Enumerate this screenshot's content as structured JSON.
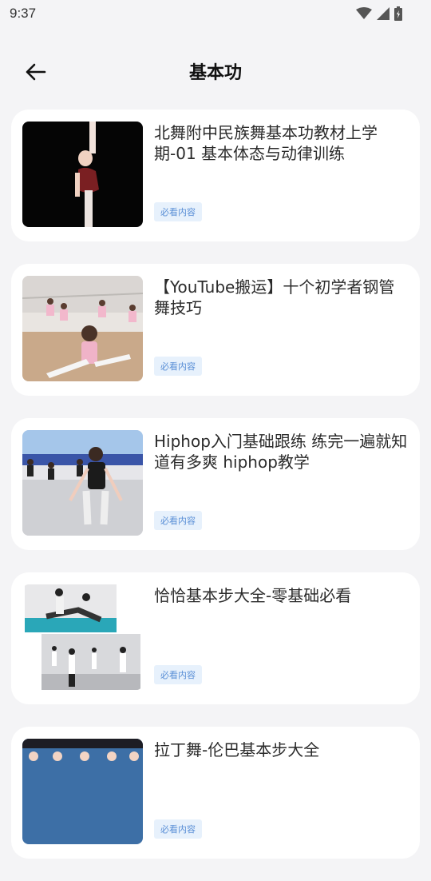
{
  "status": {
    "time": "9:37"
  },
  "header": {
    "title": "基本功"
  },
  "items": [
    {
      "title": "北舞附中民族舞基本功教材上学期-01 基本体态与动律训练",
      "badge": "必看内容"
    },
    {
      "title": "【YouTube搬运】十个初学者钢管舞技巧",
      "badge": "必看内容"
    },
    {
      "title": "Hiphop入门基础跟练 练完一遍就知道有多爽 hiphop教学",
      "badge": "必看内容"
    },
    {
      "title": "恰恰基本步大全-零基础必看",
      "badge": "必看内容"
    },
    {
      "title": "拉丁舞-伦巴基本步大全",
      "badge": "必看内容"
    }
  ]
}
